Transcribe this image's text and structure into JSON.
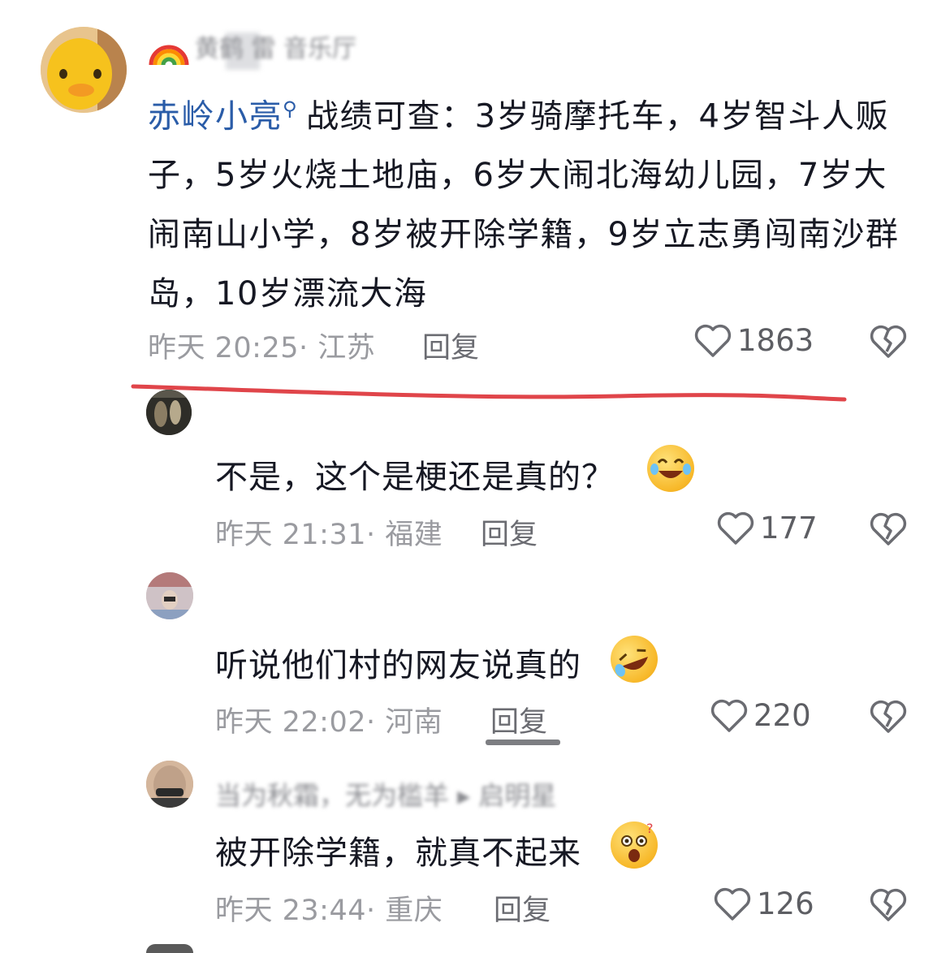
{
  "top_comment": {
    "header_blurred": "黄鹤 雷 音乐厅",
    "username": "赤岭小亮",
    "text": "战绩可查：3岁骑摩托车，4岁智斗人贩子，5岁火烧土地庙，6岁大闹北海幼儿园，7岁大闹南山小学，8岁被开除学籍，9岁立志勇闯南沙群岛，10岁漂流大海",
    "meta": "昨天 20:25· 江苏",
    "reply_label": "回复",
    "likes": "1863"
  },
  "replies": [
    {
      "text": "不是，这个是梗还是真的？",
      "emoji": "laughing-tears-emoji",
      "meta": "昨天 21:31· 福建",
      "reply_label": "回复",
      "likes": "177"
    },
    {
      "text": "听说他们村的网友说真的",
      "emoji": "rolling-laughing-emoji",
      "meta": "昨天 22:02· 河南",
      "reply_label": "回复",
      "likes": "220"
    },
    {
      "header_blurred": "当为秋霜，无为槛羊 ▸ 启明星",
      "text": "被开除学籍，就真不起来",
      "emoji": "shocked-emoji",
      "meta": "昨天 23:44· 重庆",
      "reply_label": "回复",
      "likes": "126"
    }
  ],
  "colors": {
    "username": "#2a5ca8",
    "annotation_line": "#e0454a",
    "meta": "#9a9ba0"
  }
}
